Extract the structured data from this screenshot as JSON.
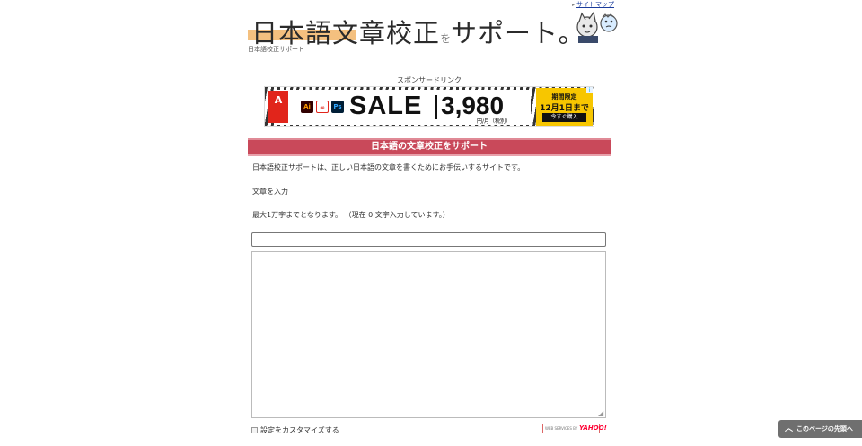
{
  "header": {
    "sitemap_link": "サイトマップ",
    "logo_main": "日本語文章校正",
    "logo_particle": "を",
    "logo_tail": "サポート。",
    "tagline": "日本語校正サポート"
  },
  "ad": {
    "sponsor_label": "スポンサードリンク",
    "brand": "A",
    "apps": [
      "Ai",
      "",
      "Ps"
    ],
    "sale": "SALE",
    "price": "3,980",
    "unit": "円/月（税別）",
    "badge_line1": "期間限定",
    "badge_line2": "12月1日まで",
    "badge_button": "今すぐ購入",
    "info": "i"
  },
  "main": {
    "heading": "日本語の文章校正をサポート",
    "intro": "日本語校正サポートは、正しい日本語の文章を書くためにお手伝いするサイトです。",
    "input_label": "文章を入力",
    "limit_text": "最大1万字までとなります。 （現在 0 文字入力しています。）",
    "title_value": "",
    "body_value": "",
    "customize_label": "設定をカスタマイズする",
    "credit_small": "WEB SERVICES BY",
    "credit_brand": "YAHOO!"
  },
  "page_top_label": "このページの先頭へ"
}
